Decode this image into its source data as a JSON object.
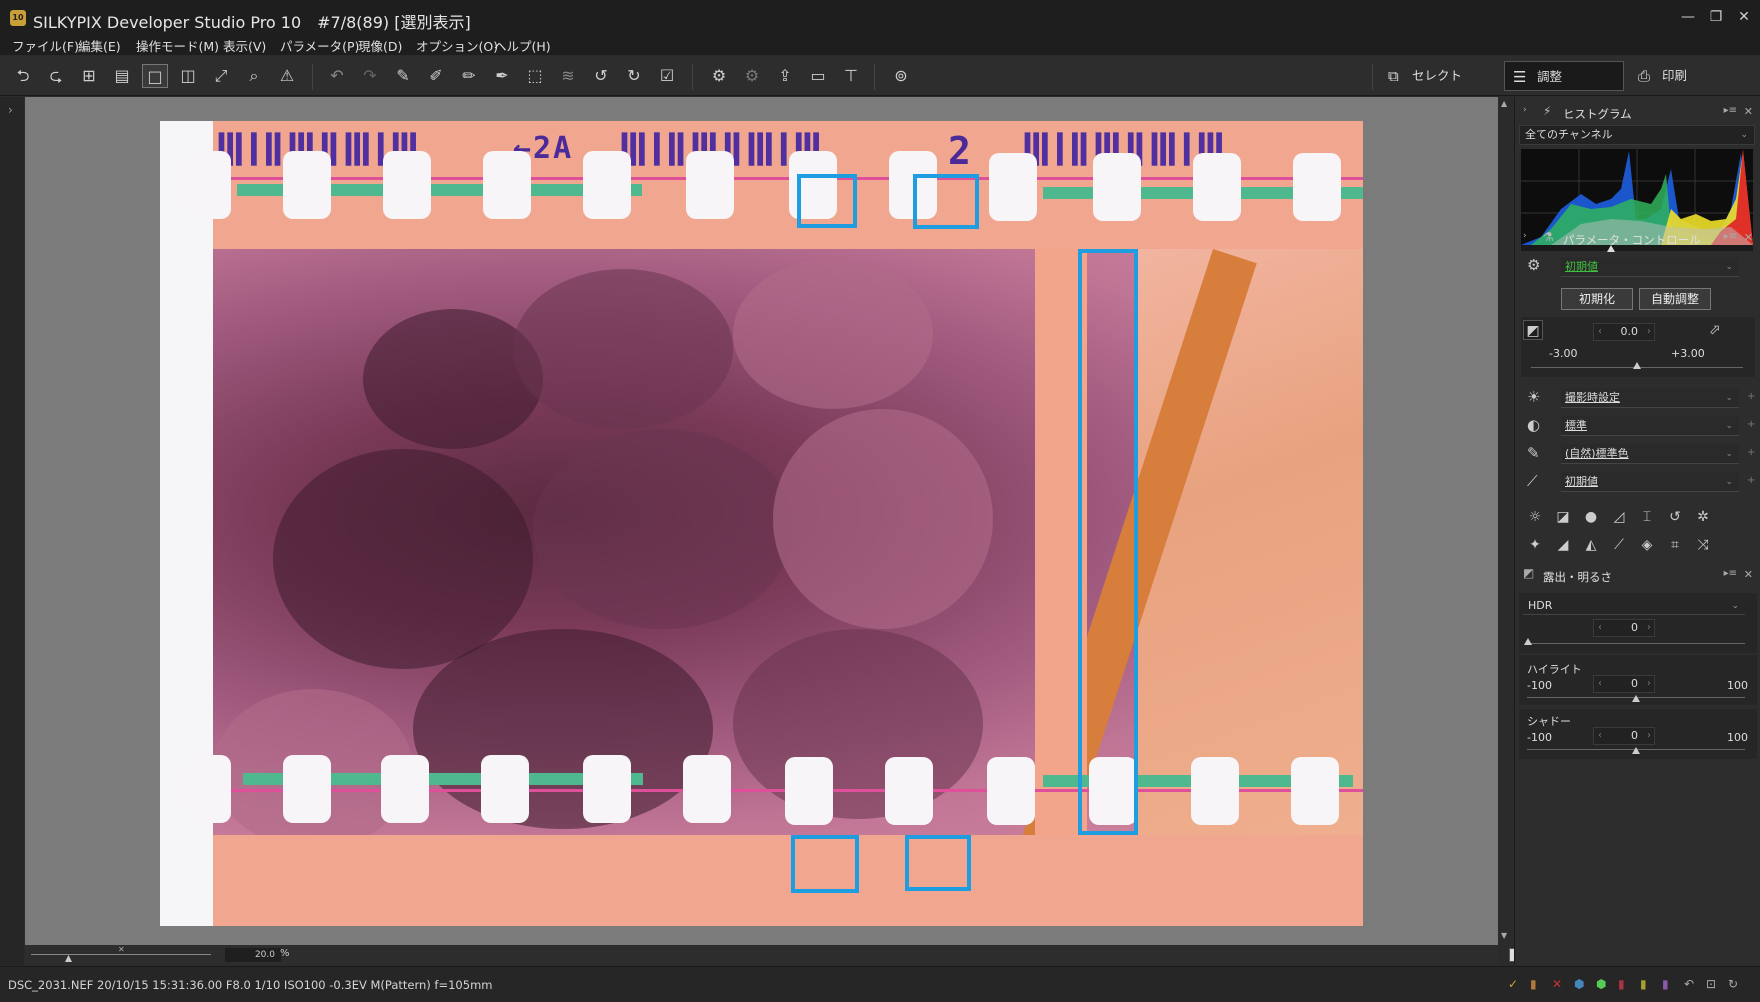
{
  "window": {
    "app_icon": "10",
    "title": "SILKYPIX Developer Studio Pro 10　#7/8(89) [選別表示]",
    "controls": {
      "minimize": "—",
      "restore": "❐",
      "close": "✕"
    }
  },
  "menu": [
    "ファイル(F)",
    "編集(E)",
    "操作モード(M)",
    "表示(V)",
    "パラメータ(P)",
    "現像(D)",
    "オプション(O)",
    "ヘルプ(H)"
  ],
  "toolbar": {
    "icons": [
      "prev-image-icon",
      "next-image-icon",
      "thumbnail-view-icon",
      "filmstrip-view-icon",
      "single-view-icon",
      "compare-view-icon",
      "fit-view-icon",
      "zoom-icon",
      "warning-icon",
      "undo-icon",
      "redo-icon",
      "copy-params-icon",
      "paste-params-icon",
      "stamp-icon",
      "eyedropper-icon",
      "crop-icon",
      "layers-icon",
      "rotate-left-icon",
      "rotate-right-icon",
      "mark-icon",
      "batch-icon",
      "batch-settings-icon",
      "export-icon",
      "fullscreen-icon",
      "tool-icon",
      "loupe-icon"
    ],
    "modes": {
      "select": "セレクト",
      "adjust": "調整",
      "print": "印刷"
    }
  },
  "viewer": {
    "edge_code": "ⅢⅠⅡⅢⅡⅢⅠⅢ",
    "edge_label": "←2A",
    "frame_number": "2"
  },
  "zoom": {
    "value": "20.0",
    "unit": "%"
  },
  "status": {
    "text": "DSC_2031.NEF 20/10/15 15:31:36.00 F8.0 1/10 ISO100 -0.3EV M(Pattern) f=105mm"
  },
  "panels": {
    "histogram": {
      "title": "ヒストグラム",
      "channel": "全てのチャンネル"
    },
    "param_control": {
      "title": "パラメータ・コントロール",
      "preset": "初期値",
      "reset_btn": "初期化",
      "auto_btn": "自動調整",
      "exposure": {
        "value": "0.0",
        "min": "-3.00",
        "max": "+3.00",
        "fraction": 0.5
      },
      "rows": [
        {
          "icon": "sun-icon",
          "value": "撮影時設定"
        },
        {
          "icon": "contrast-icon",
          "value": "標準"
        },
        {
          "icon": "pen-icon",
          "value": "(自然)標準色"
        },
        {
          "icon": "tone-curve-icon",
          "value": "初期値"
        }
      ]
    },
    "exposure_panel": {
      "title": "露出・明るさ",
      "hdr_label": "HDR",
      "hdr_value": "0",
      "highlight": {
        "label": "ハイライト",
        "value": "0",
        "min": "-100",
        "max": "100",
        "fraction": 0.5
      },
      "shadow": {
        "label": "シャドー",
        "value": "0",
        "min": "-100",
        "max": "100",
        "fraction": 0.5
      }
    }
  },
  "colors": {
    "accent": "#1e9ee0",
    "preset_green": "#3fbf3f"
  }
}
